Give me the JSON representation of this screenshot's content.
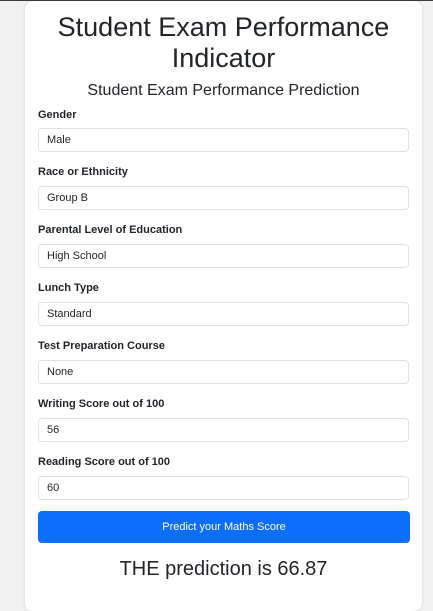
{
  "title_line1": "Student Exam Performance",
  "title_line2": "Indicator",
  "subtitle": "Student Exam Performance Prediction",
  "fields": [
    {
      "label": "Gender",
      "value": "Male"
    },
    {
      "label": "Race or Ethnicity",
      "value": "Group B"
    },
    {
      "label": "Parental Level of Education",
      "value": "High School"
    },
    {
      "label": "Lunch Type",
      "value": "Standard"
    },
    {
      "label": "Test Preparation Course",
      "value": "None"
    },
    {
      "label": "Writing Score out of 100",
      "value": "56"
    },
    {
      "label": "Reading Score out of 100",
      "value": "60"
    }
  ],
  "submit_label": "Predict your Maths Score",
  "result_text": "THE prediction is 66.87",
  "colors": {
    "primary_button": "#0d6efd",
    "field_border": "#dee2e6",
    "page_background": "#f1f1f1"
  }
}
